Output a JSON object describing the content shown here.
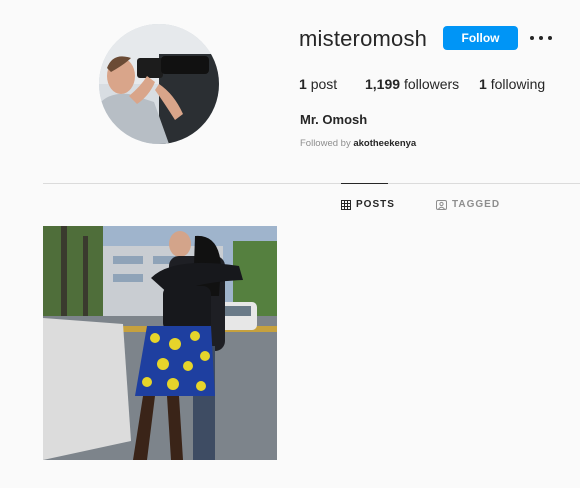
{
  "profile": {
    "username": "misteromosh",
    "full_name": "Mr. Omosh",
    "follow_label": "Follow",
    "more_icon": "more-options-icon",
    "followed_by_prefix": "Followed by",
    "followed_by_user": "akotheekenya"
  },
  "stats": {
    "posts_count": "1",
    "posts_label": "post",
    "followers_count": "1,199",
    "followers_label": "followers",
    "following_count": "1",
    "following_label": "following"
  },
  "tabs": [
    {
      "label": "POSTS",
      "icon": "grid-icon",
      "active": true
    },
    {
      "label": "TAGGED",
      "icon": "tagged-icon",
      "active": false
    }
  ],
  "colors": {
    "accent": "#0095f6",
    "background": "#fafafa",
    "text": "#262626",
    "muted": "#8e8e8e"
  }
}
